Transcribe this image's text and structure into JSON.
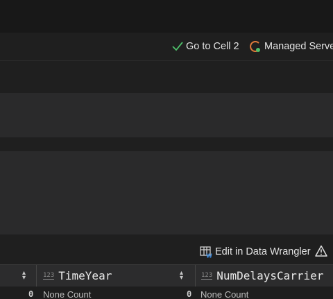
{
  "toolbar": {
    "goto_cell_label": "Go to Cell 2",
    "server_label": "Managed Serve"
  },
  "output": {
    "wrangler_label": "Edit in Data Wrangler"
  },
  "grid": {
    "columns": [
      {
        "type": "123",
        "title": "TimeYear"
      },
      {
        "type": "123",
        "title": "NumDelaysCarrier"
      }
    ],
    "row": {
      "col0_value": "0",
      "col1_text": "None Count",
      "col1_value": "0",
      "col2_text": "None Count"
    }
  }
}
